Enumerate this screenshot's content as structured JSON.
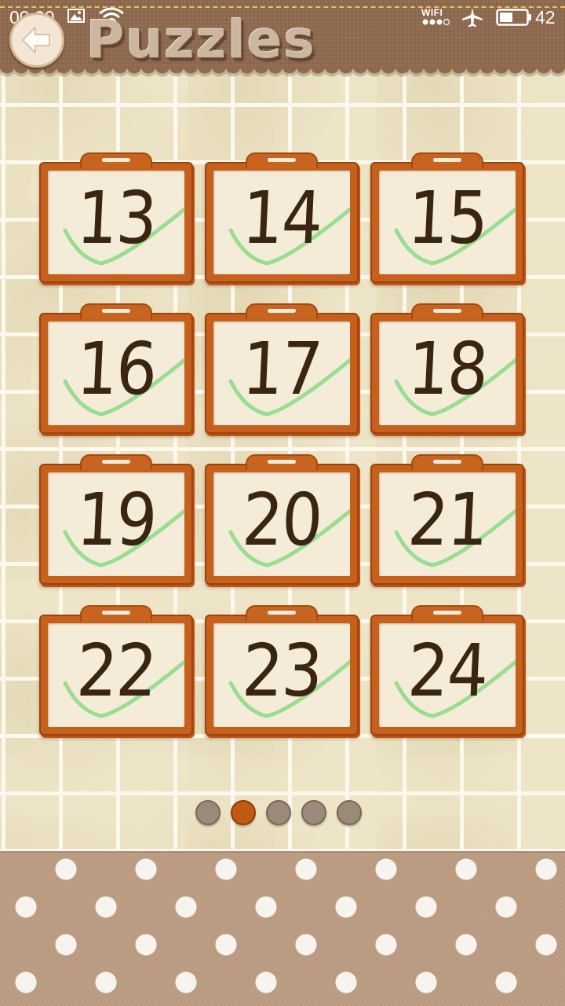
{
  "status_bar": {
    "time": "00:20",
    "wifi_label": "WIFI",
    "battery_level": "42",
    "icons": [
      "image-icon",
      "wifi-icon",
      "signal-dots-icon",
      "airplane-icon",
      "battery-icon"
    ]
  },
  "header": {
    "title": "Puzzles",
    "back_icon": "back-arrow-icon"
  },
  "puzzles": [
    {
      "number": "13",
      "completed": true
    },
    {
      "number": "14",
      "completed": true
    },
    {
      "number": "15",
      "completed": true
    },
    {
      "number": "16",
      "completed": true
    },
    {
      "number": "17",
      "completed": true
    },
    {
      "number": "18",
      "completed": true
    },
    {
      "number": "19",
      "completed": true
    },
    {
      "number": "20",
      "completed": true
    },
    {
      "number": "21",
      "completed": true
    },
    {
      "number": "22",
      "completed": true
    },
    {
      "number": "23",
      "completed": true
    },
    {
      "number": "24",
      "completed": true
    }
  ],
  "pagination": {
    "total_pages": 5,
    "current_page": 2
  },
  "colors": {
    "header_bg": "#8f6a4f",
    "card_frame": "#c6611d",
    "check_mark": "#8fdc8a",
    "number_ink": "#3a2412",
    "active_dot": "#c25a14",
    "inactive_dot": "#9b8a7a",
    "footer_bg": "#b99a80"
  }
}
